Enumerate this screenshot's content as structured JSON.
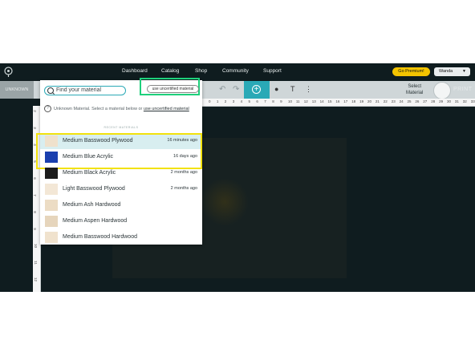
{
  "nav": {
    "links": [
      "Dashboard",
      "Catalog",
      "Shop",
      "Community",
      "Support"
    ],
    "premium": "Go Premium!",
    "user": "Wanda"
  },
  "toolbar": {
    "material_status": "UNKNOWN",
    "select_material": "Select\nMaterial",
    "print": "PRINT"
  },
  "ruler": {
    "top": [
      "0",
      "1",
      "2",
      "3",
      "4",
      "5",
      "6",
      "7",
      "8",
      "9",
      "10",
      "11",
      "12",
      "13",
      "14",
      "15",
      "16",
      "17",
      "18",
      "19",
      "20",
      "21",
      "22",
      "23",
      "24",
      "25",
      "26",
      "27",
      "28",
      "29",
      "30",
      "31",
      "32",
      "33"
    ],
    "left": [
      "2",
      "3",
      "4",
      "5",
      "6",
      "7",
      "8",
      "9",
      "10",
      "11",
      "12"
    ]
  },
  "material_panel": {
    "search_placeholder": "Find your material",
    "uncertified_button": "use uncertified material",
    "notice_text": "Unknown Material. Select a material below or ",
    "notice_link": "use uncertified material",
    "section_label": "RECENT MATERIALS",
    "recent": [
      {
        "name": "Medium Basswood Plywood",
        "time": "16 minutes ago",
        "color": "#efe1cc"
      },
      {
        "name": "Medium Blue Acrylic",
        "time": "16 days ago",
        "color": "#1a3fae"
      }
    ],
    "others": [
      {
        "name": "Medium Black Acrylic",
        "time": "2 months ago",
        "color": "#1c1c1c"
      },
      {
        "name": "Light Basswood Plywood",
        "time": "2 months ago",
        "color": "#f3e7d6"
      },
      {
        "name": "Medium Ash Hardwood",
        "time": "",
        "color": "#ecdcc4"
      },
      {
        "name": "Medium Aspen Hardwood",
        "time": "",
        "color": "#e6d5bc"
      },
      {
        "name": "Medium Basswood Hardwood",
        "time": "",
        "color": "#f0e2cd"
      }
    ]
  }
}
